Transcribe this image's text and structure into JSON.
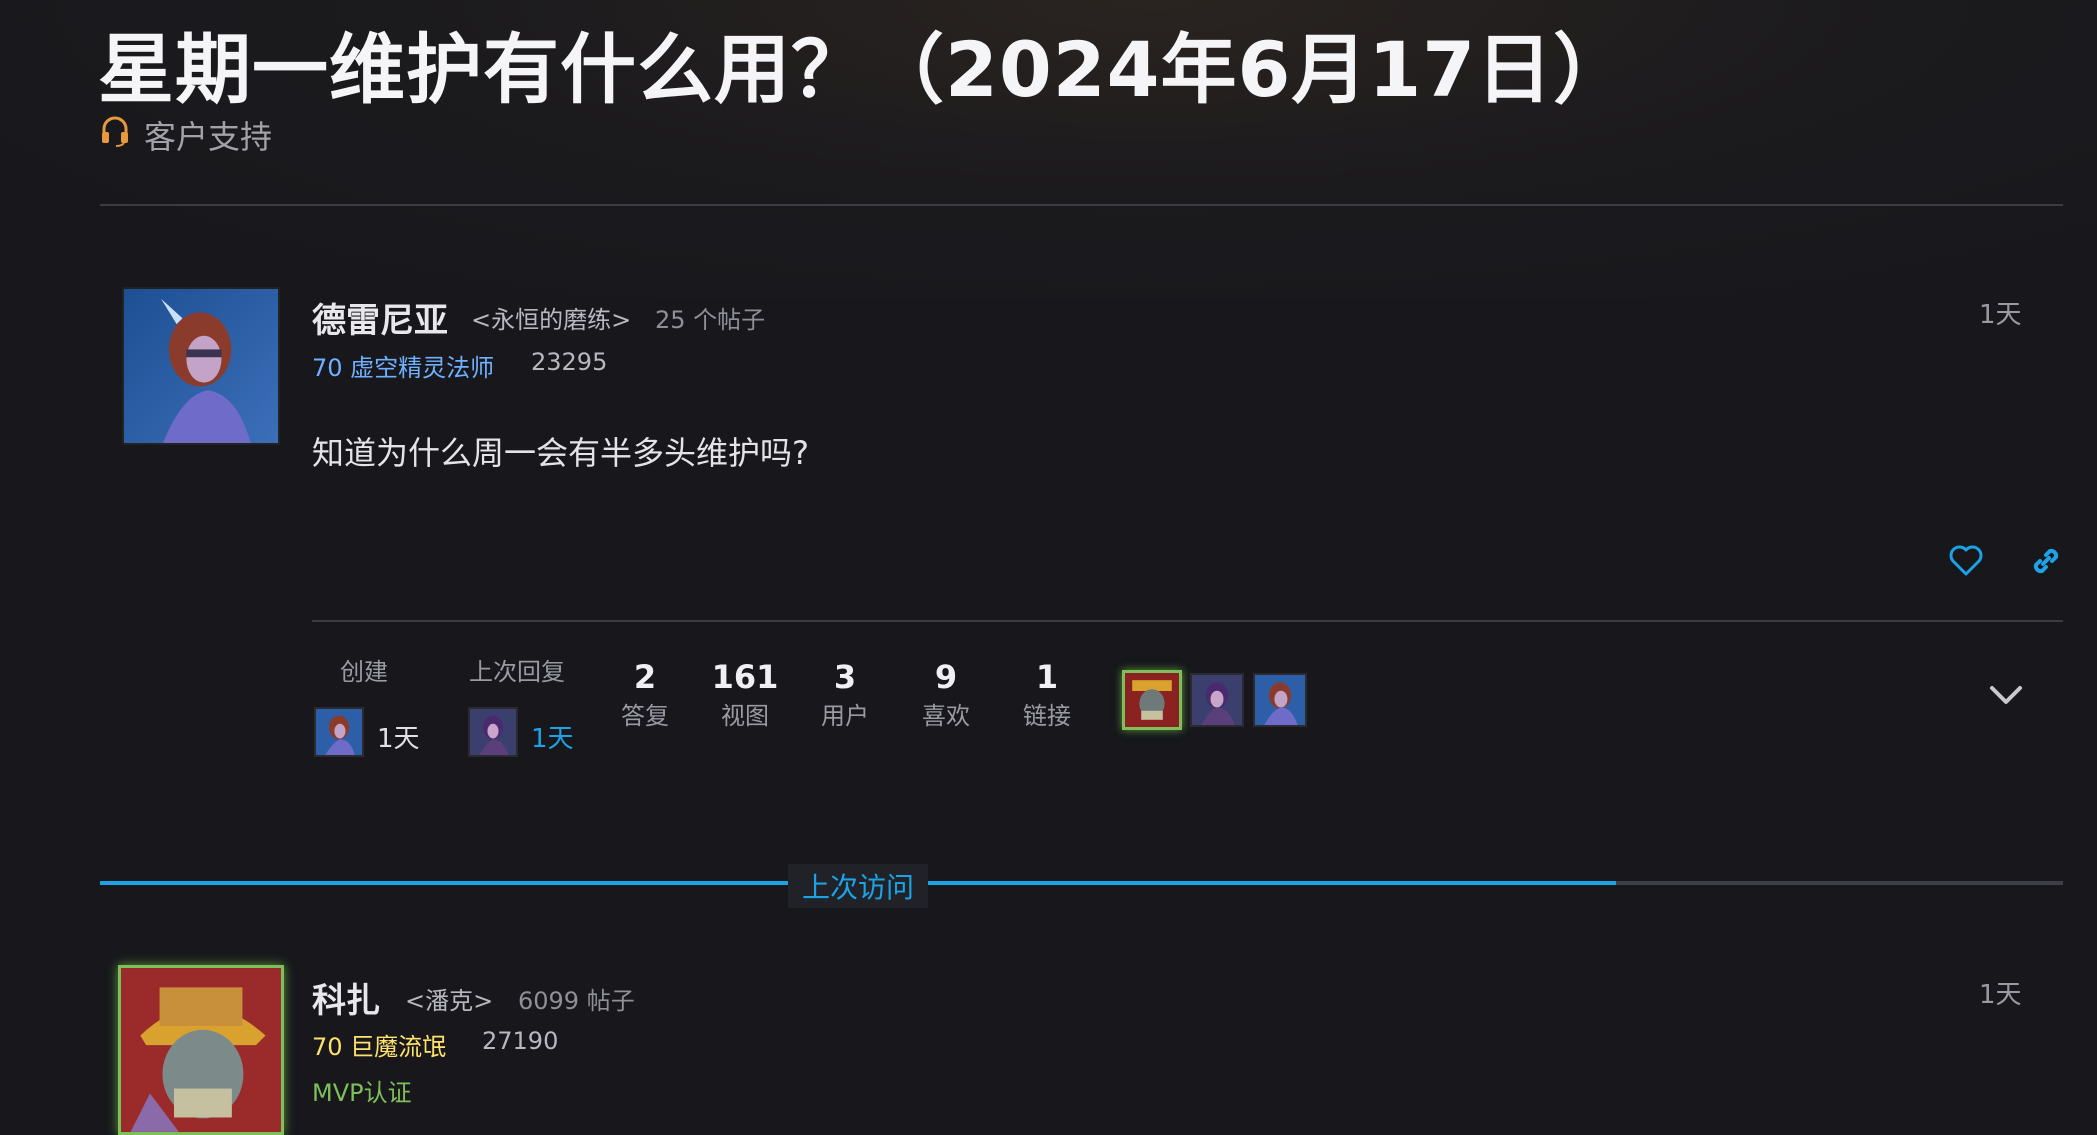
{
  "topic": {
    "title": "星期一维护有什么用？（2024年6月17日）",
    "category": "客户支持",
    "category_icon": "headset-icon"
  },
  "first_post": {
    "author_name": "德雷尼亚",
    "guild": "<永恒的磨练>",
    "post_count": "25 个帖子",
    "class_level": "70 虚空精灵法师",
    "achievement_points": "23295",
    "time": "1天",
    "body": "知道为什么周一会有半多头维护吗?",
    "actions": [
      "heart-icon",
      "link-icon"
    ]
  },
  "topic_map": {
    "created_label": "创建",
    "created_time": "1天",
    "last_reply_label": "上次回复",
    "last_reply_time": "1天",
    "stats": [
      {
        "value": "2",
        "label": "答复"
      },
      {
        "value": "161",
        "label": "视图"
      },
      {
        "value": "3",
        "label": "用户"
      },
      {
        "value": "9",
        "label": "喜欢"
      },
      {
        "value": "1",
        "label": "链接"
      }
    ]
  },
  "last_visit_divider": "上次访问",
  "second_post": {
    "author_name": "科扎",
    "guild": "<潘克>",
    "post_count": "6099 帖子",
    "class_level": "70 巨魔流氓",
    "achievement_points": "27190",
    "badge": "MVP认证",
    "time": "1天"
  },
  "colors": {
    "accent_blue": "#1ba3e6",
    "mage_blue": "#6fb1ff",
    "rogue_yellow": "#ffe26b",
    "mvp_green": "#7fbf5a"
  }
}
